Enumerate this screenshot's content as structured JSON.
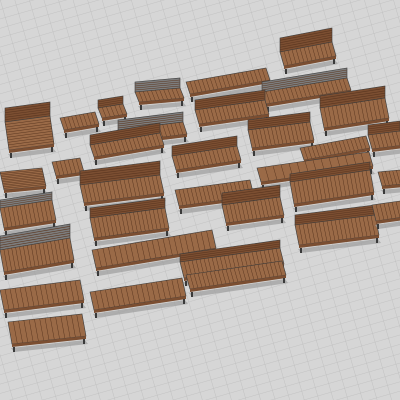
{
  "scene": {
    "colors": {
      "ground": "#d5d5d5",
      "ground_grid": "#b9b9b9",
      "wood_top": "#9a6a47",
      "wood_front": "#7b4e31",
      "slat_line": "#5a3620",
      "metal": "#3a3a3a",
      "metal_light": "#7d7d7d",
      "shadow": "#9d9d9d"
    },
    "furniture_styles": [
      "slatted-bench",
      "bench-with-backrest",
      "curved-bench",
      "metal-frame-bench",
      "modular-seat-bench",
      "railing-bench"
    ]
  }
}
